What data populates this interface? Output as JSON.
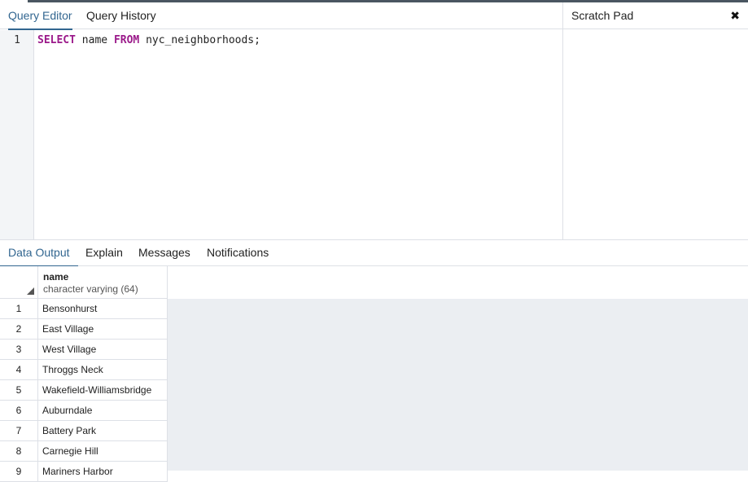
{
  "editor_tabs": [
    {
      "label": "Query Editor",
      "active": true
    },
    {
      "label": "Query History",
      "active": false
    }
  ],
  "scratch_pad": {
    "title": "Scratch Pad",
    "close_icon": "close-icon"
  },
  "editor": {
    "line_numbers": [
      "1"
    ],
    "query": {
      "kw1": "SELECT",
      "t1": " name ",
      "kw2": "FROM",
      "t2": " nyc_neighborhoods;"
    }
  },
  "output_tabs": [
    {
      "label": "Data Output",
      "active": true
    },
    {
      "label": "Explain",
      "active": false
    },
    {
      "label": "Messages",
      "active": false
    },
    {
      "label": "Notifications",
      "active": false
    }
  ],
  "grid": {
    "columns": [
      {
        "name": "name",
        "type": "character varying (64)"
      }
    ],
    "rows": [
      {
        "num": "1",
        "name": "Bensonhurst"
      },
      {
        "num": "2",
        "name": "East Village"
      },
      {
        "num": "3",
        "name": "West Village"
      },
      {
        "num": "4",
        "name": "Throggs Neck"
      },
      {
        "num": "5",
        "name": "Wakefield-Williamsbridge"
      },
      {
        "num": "6",
        "name": "Auburndale"
      },
      {
        "num": "7",
        "name": "Battery Park"
      },
      {
        "num": "8",
        "name": "Carnegie Hill"
      },
      {
        "num": "9",
        "name": "Mariners Harbor"
      }
    ]
  },
  "colors": {
    "accent": "#326690",
    "keyword": "#9b1a8a",
    "grid_bg": "#ebeef2"
  }
}
